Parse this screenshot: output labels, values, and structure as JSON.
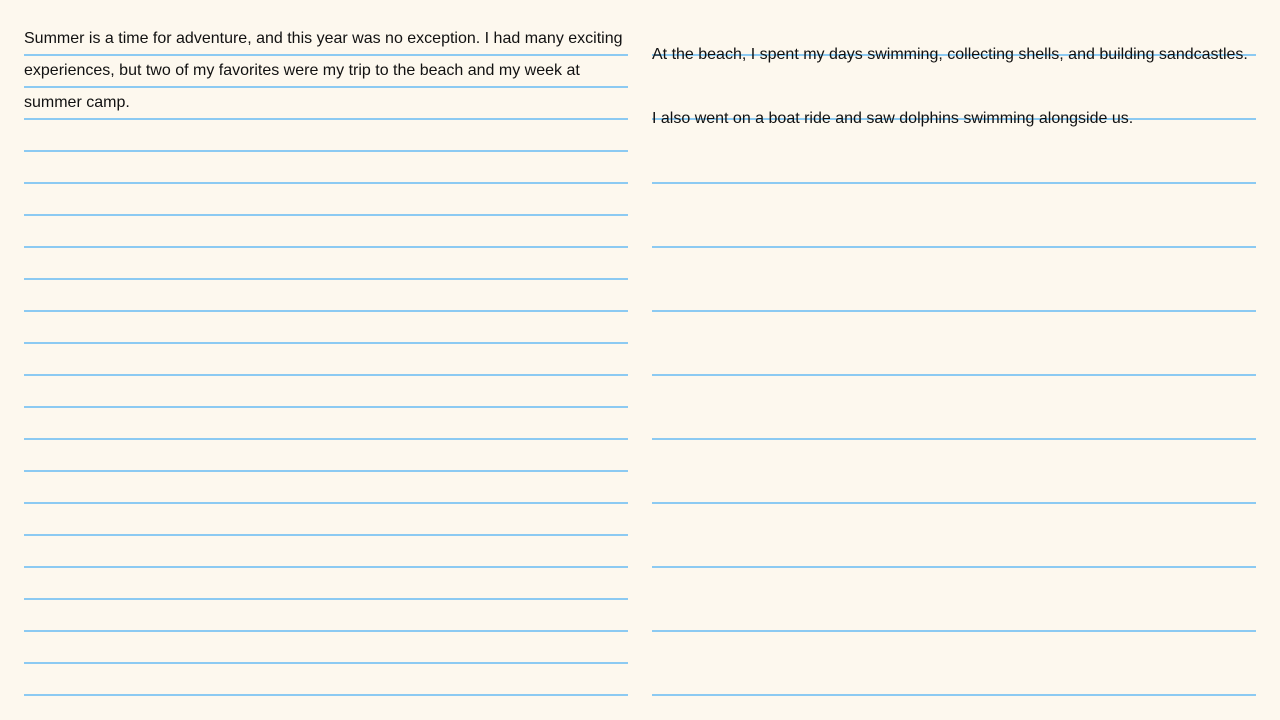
{
  "left_column": {
    "paragraph": "Summer is a time for adventure, and this year was no exception. I had many exciting experiences, but two of my favorites were my trip to the beach and my week at summer camp."
  },
  "right_column": {
    "lines": [
      "At the beach, I spent my days swimming, collecting shells, and building sandcastles.",
      "I also went on a boat ride and saw dolphins swimming alongside us."
    ]
  },
  "colors": {
    "paper": "#fdf8ee",
    "rule": "#8ccaf2",
    "ink": "#111111"
  }
}
